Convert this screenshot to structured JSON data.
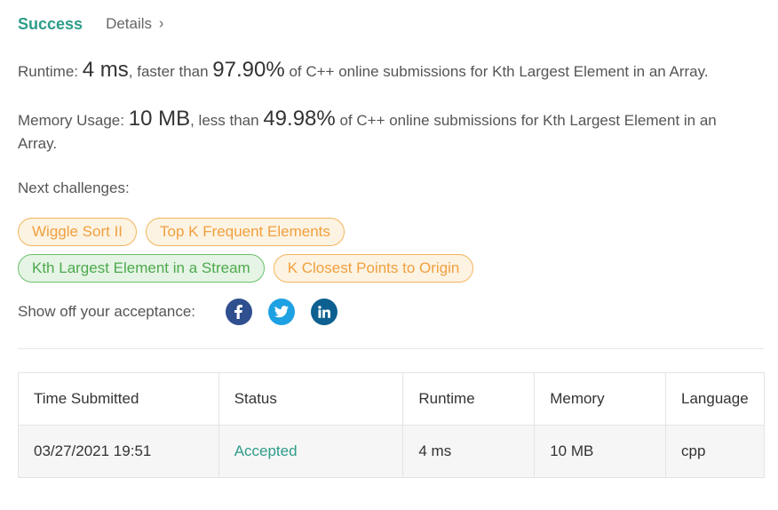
{
  "header": {
    "status": "Success",
    "details_label": "Details",
    "chevron": "›"
  },
  "runtime": {
    "label": "Runtime:",
    "value": "4 ms",
    "mid": ", faster than",
    "percent": "97.90%",
    "suffix": "of C++ online submissions for Kth Largest Element in an Array."
  },
  "memory": {
    "label": "Memory Usage:",
    "value": "10 MB",
    "mid": ", less than",
    "percent": "49.98%",
    "suffix": "of C++ online submissions for Kth Largest Element in an Array."
  },
  "next_challenges": {
    "label": "Next challenges:",
    "row1": [
      {
        "label": "Wiggle Sort II",
        "difficulty": "medium"
      },
      {
        "label": "Top K Frequent Elements",
        "difficulty": "medium"
      }
    ],
    "row2": [
      {
        "label": "Kth Largest Element in a Stream",
        "difficulty": "easy"
      },
      {
        "label": "K Closest Points to Origin",
        "difficulty": "medium"
      }
    ]
  },
  "share": {
    "label": "Show off your acceptance:",
    "icons": [
      "facebook-icon",
      "twitter-icon",
      "linkedin-icon"
    ]
  },
  "table": {
    "headers": [
      "Time Submitted",
      "Status",
      "Runtime",
      "Memory",
      "Language"
    ],
    "rows": [
      [
        "03/27/2021 19:51",
        "Accepted",
        "4 ms",
        "10 MB",
        "cpp"
      ]
    ]
  },
  "colors": {
    "success": "#2e9c8a",
    "medium_tag": "#f0a040",
    "easy_tag": "#4caa4c",
    "facebook": "#2f4f8f",
    "twitter": "#1da1e2",
    "linkedin": "#0d6090"
  }
}
